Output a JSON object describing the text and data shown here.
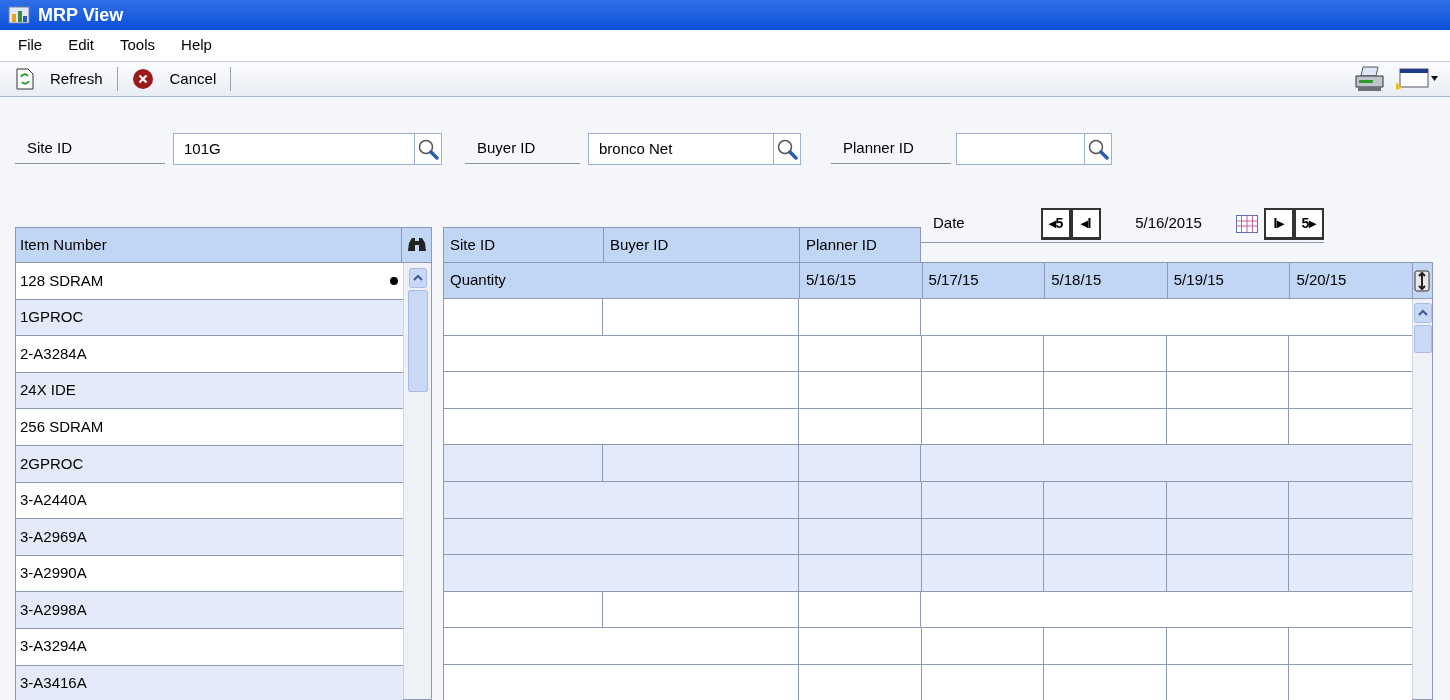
{
  "window": {
    "title": "MRP View"
  },
  "menu": [
    "File",
    "Edit",
    "Tools",
    "Help"
  ],
  "toolbar": {
    "buttons": [
      {
        "label": "Refresh",
        "kind": "refresh"
      },
      {
        "label": "Cancel",
        "kind": "cancel"
      }
    ]
  },
  "filters": [
    {
      "label": "Site ID",
      "value": "101G"
    },
    {
      "label": "Buyer ID",
      "value": "bronco Net"
    },
    {
      "label": "Planner ID"
    }
  ],
  "date": {
    "label": "Date",
    "value": "5/16/2015",
    "back_buttons": [
      "◂5",
      "◂I"
    ],
    "forward_buttons": [
      "I▸",
      "5▸"
    ]
  },
  "items": {
    "header": "Item Number",
    "rows": [
      {
        "label": "128 SDRAM",
        "selected": true
      },
      {
        "label": "1GPROC",
        "selected": false
      },
      {
        "label": "2-A3284A",
        "selected": false
      },
      {
        "label": "24X IDE",
        "selected": false
      },
      {
        "label": "256 SDRAM",
        "selected": false
      },
      {
        "label": "2GPROC",
        "selected": false
      },
      {
        "label": "3-A2440A",
        "selected": false
      },
      {
        "label": "3-A2969A",
        "selected": false
      },
      {
        "label": "3-A2990A",
        "selected": false
      },
      {
        "label": "3-A2998A",
        "selected": false
      },
      {
        "label": "3-A3294A",
        "selected": false
      },
      {
        "label": "3-A3416A",
        "selected": false
      }
    ]
  },
  "grid": {
    "columns": [
      "Site ID",
      "Buyer ID",
      "Planner ID"
    ],
    "quantity_header": "Quantity",
    "dates": [
      "5/16/15",
      "5/17/15",
      "5/18/15",
      "5/19/15",
      "5/20/15"
    ]
  }
}
